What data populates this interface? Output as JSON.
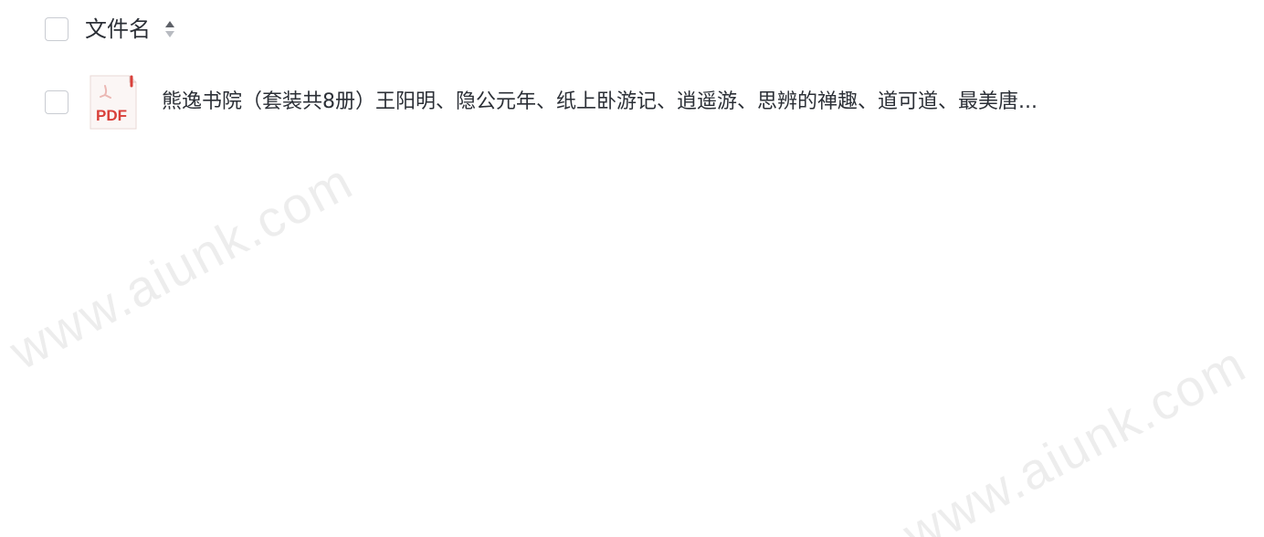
{
  "header": {
    "column_title": "文件名",
    "sort_icon": "sort-updown-icon"
  },
  "files": [
    {
      "icon": "pdf-file-icon",
      "icon_label": "PDF",
      "name": "熊逸书院（套装共8册）王阳明、隐公元年、纸上卧游记、逍遥游、思辨的禅趣、道可道、最美唐..."
    }
  ],
  "watermarks": [
    "www.aiunk.com",
    "www.aiunk.com"
  ],
  "colors": {
    "pdf_red": "#d9403a",
    "text": "#2b2f36",
    "checkbox_border": "#c9ccd2"
  }
}
